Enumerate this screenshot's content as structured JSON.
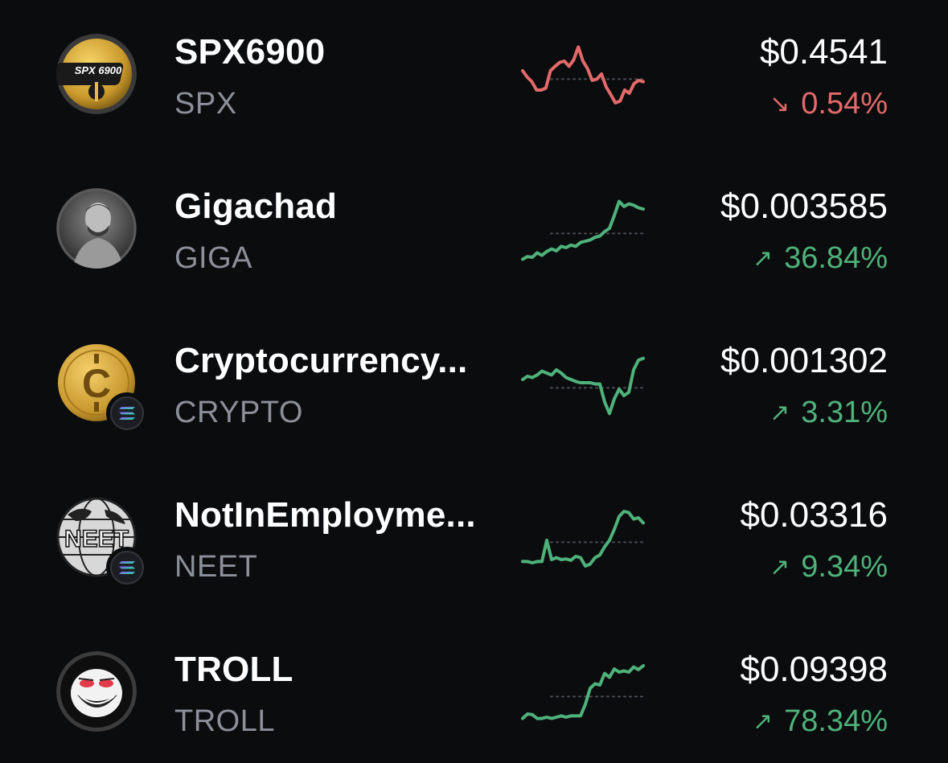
{
  "colors": {
    "background": "#0b0c0e",
    "up": "#4fb27a",
    "down": "#e46a6a",
    "secondary_text": "#8b9099"
  },
  "tokens": [
    {
      "name": "SPX6900",
      "symbol": "SPX",
      "price": "$0.4541",
      "change": "0.54%",
      "direction": "down",
      "arrow": "↘",
      "chain_badge": "",
      "avatar_icon": "spx6900-logo-icon",
      "avatar_text": "SPX 6900",
      "spark": [
        0.55,
        0.45,
        0.38,
        0.25,
        0.25,
        0.28,
        0.55,
        0.62,
        0.68,
        0.7,
        0.62,
        0.72,
        0.92,
        0.7,
        0.58,
        0.4,
        0.42,
        0.5,
        0.3,
        0.18,
        0.05,
        0.08,
        0.25,
        0.2,
        0.35,
        0.4,
        0.38
      ]
    },
    {
      "name": "Gigachad",
      "symbol": "GIGA",
      "price": "$0.003585",
      "change": "36.84%",
      "direction": "up",
      "arrow": "↗",
      "chain_badge": "",
      "avatar_icon": "gigachad-portrait-icon",
      "avatar_text": "",
      "spark": [
        0.02,
        0.06,
        0.05,
        0.12,
        0.08,
        0.14,
        0.18,
        0.15,
        0.22,
        0.2,
        0.24,
        0.22,
        0.28,
        0.3,
        0.32,
        0.36,
        0.38,
        0.45,
        0.5,
        0.7,
        0.92,
        0.84,
        0.88,
        0.86,
        0.82,
        0.8
      ]
    },
    {
      "name": "Cryptocurrency...",
      "symbol": "CRYPTO",
      "price": "$0.001302",
      "change": "3.31%",
      "direction": "up",
      "arrow": "↗",
      "chain_badge": "solana-badge-icon",
      "avatar_icon": "crypto-coin-icon",
      "avatar_text": "C",
      "spark": [
        0.55,
        0.6,
        0.58,
        0.62,
        0.68,
        0.65,
        0.62,
        0.7,
        0.65,
        0.58,
        0.55,
        0.52,
        0.5,
        0.5,
        0.5,
        0.48,
        0.48,
        0.2,
        0.02,
        0.25,
        0.4,
        0.3,
        0.35,
        0.7,
        0.85,
        0.88
      ]
    },
    {
      "name": "NotInEmployme...",
      "symbol": "NEET",
      "price": "$0.03316",
      "change": "9.34%",
      "direction": "up",
      "arrow": "↗",
      "chain_badge": "solana-badge-icon",
      "avatar_icon": "neet-globe-logo-icon",
      "avatar_text": "NEET",
      "spark": [
        0.12,
        0.12,
        0.1,
        0.12,
        0.12,
        0.45,
        0.15,
        0.18,
        0.15,
        0.16,
        0.14,
        0.2,
        0.18,
        0.05,
        0.08,
        0.18,
        0.22,
        0.35,
        0.45,
        0.62,
        0.82,
        0.9,
        0.88,
        0.78,
        0.8,
        0.72
      ]
    },
    {
      "name": "TROLL",
      "symbol": "TROLL",
      "price": "$0.09398",
      "change": "78.34%",
      "direction": "up",
      "arrow": "↗",
      "chain_badge": "",
      "avatar_icon": "trollface-icon",
      "avatar_text": "",
      "spark": [
        0.08,
        0.15,
        0.14,
        0.08,
        0.08,
        0.1,
        0.08,
        0.1,
        0.12,
        0.1,
        0.12,
        0.12,
        0.12,
        0.3,
        0.55,
        0.62,
        0.6,
        0.78,
        0.72,
        0.85,
        0.8,
        0.82,
        0.8,
        0.88,
        0.84,
        0.9
      ]
    }
  ]
}
